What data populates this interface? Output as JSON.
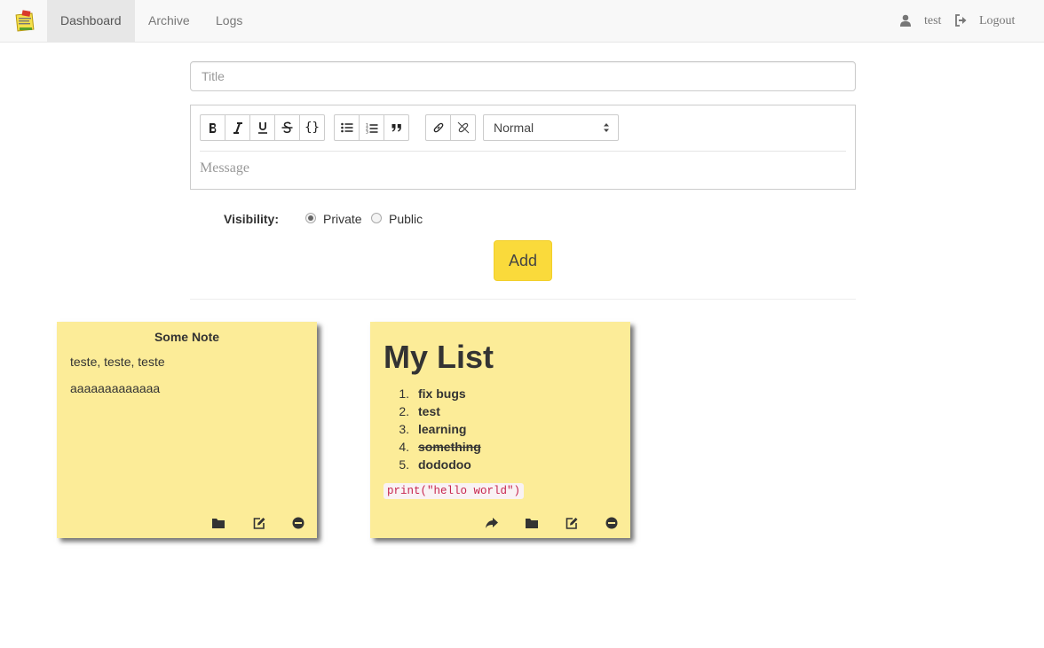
{
  "nav": {
    "brand_icon": "notes-logo-icon",
    "tabs": [
      {
        "label": "Dashboard",
        "active": true
      },
      {
        "label": "Archive",
        "active": false
      },
      {
        "label": "Logs",
        "active": false
      }
    ],
    "user_label": "test",
    "logout_label": "Logout"
  },
  "form": {
    "title_placeholder": "Title",
    "toolbar": {
      "buttons": [
        "bold",
        "italic",
        "underline",
        "strikethrough",
        "code-block",
        "bullet-list",
        "ordered-list",
        "blockquote",
        "link",
        "unlink"
      ],
      "format_select": "Normal"
    },
    "message_placeholder": "Message",
    "visibility_label": "Visibility:",
    "visibility_options": [
      {
        "label": "Private",
        "checked": true
      },
      {
        "label": "Public",
        "checked": false
      }
    ],
    "add_label": "Add"
  },
  "notes": [
    {
      "title": "Some Note",
      "paragraphs": [
        "teste, teste, teste",
        "aaaaaaaaaaaaa"
      ],
      "actions": [
        "archive-icon",
        "edit-icon",
        "delete-icon"
      ]
    },
    {
      "heading": "My List",
      "list": [
        {
          "num": "1.",
          "text": "fix bugs",
          "strike": false
        },
        {
          "num": "2.",
          "text": "test",
          "strike": false
        },
        {
          "num": "3.",
          "text": "learning",
          "strike": false
        },
        {
          "num": "4.",
          "text": "something",
          "strike": true
        },
        {
          "num": "5.",
          "text": "dododoo",
          "strike": false
        }
      ],
      "code": "print(\"hello world\")",
      "actions": [
        "share-icon",
        "archive-icon",
        "edit-icon",
        "delete-icon"
      ]
    }
  ],
  "colors": {
    "note_bg": "#fcec98",
    "add_button": "#fada3b",
    "navbar_bg": "#f8f8f8",
    "code_text": "#c7254e"
  }
}
